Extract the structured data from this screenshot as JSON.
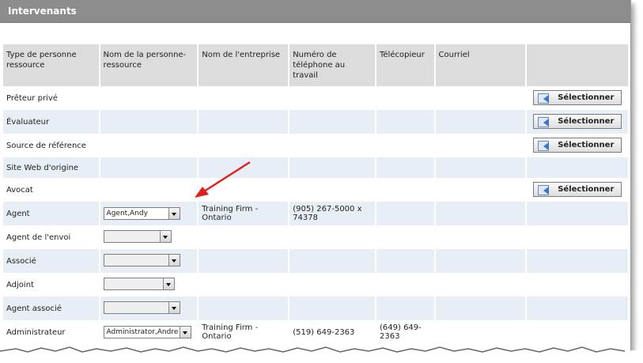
{
  "window": {
    "title": "Intervenants"
  },
  "columns": [
    "Type de personne ressource",
    "Nom de la personne-ressource",
    "Nom de l'entreprise",
    "Numéro de téléphone au travail",
    "Télécopieur",
    "Courriel",
    ""
  ],
  "select_label": "Sélectionner",
  "rows": [
    {
      "type": "Prêteur privé"
    },
    {
      "type": "Évaluateur"
    },
    {
      "type": "Source de référence"
    },
    {
      "type": "Site Web d'origine"
    },
    {
      "type": "Avocat"
    },
    {
      "type": "Agent",
      "name": "Agent,Andy",
      "company": "Training Firm - Ontario",
      "phone": "(905) 267-5000 x 74378"
    },
    {
      "type": "Agent de l'envoi"
    },
    {
      "type": "Associé"
    },
    {
      "type": "Adjoint"
    },
    {
      "type": "Agent associé"
    },
    {
      "type": "Administrateur",
      "name": "Administrator,Andre",
      "company": "Training Firm - Ontario",
      "phone": "(519) 649-2363",
      "fax": "(649) 649-2363"
    }
  ],
  "colors": {
    "titlebar": "#8c8c8c",
    "header_bg": "#dcdcdc",
    "alt_row": "#e8eef6",
    "annotation_arrow": "#e02020"
  },
  "icons": {
    "select_button": "contact-select-icon",
    "dropdown": "chevron-down-icon"
  }
}
